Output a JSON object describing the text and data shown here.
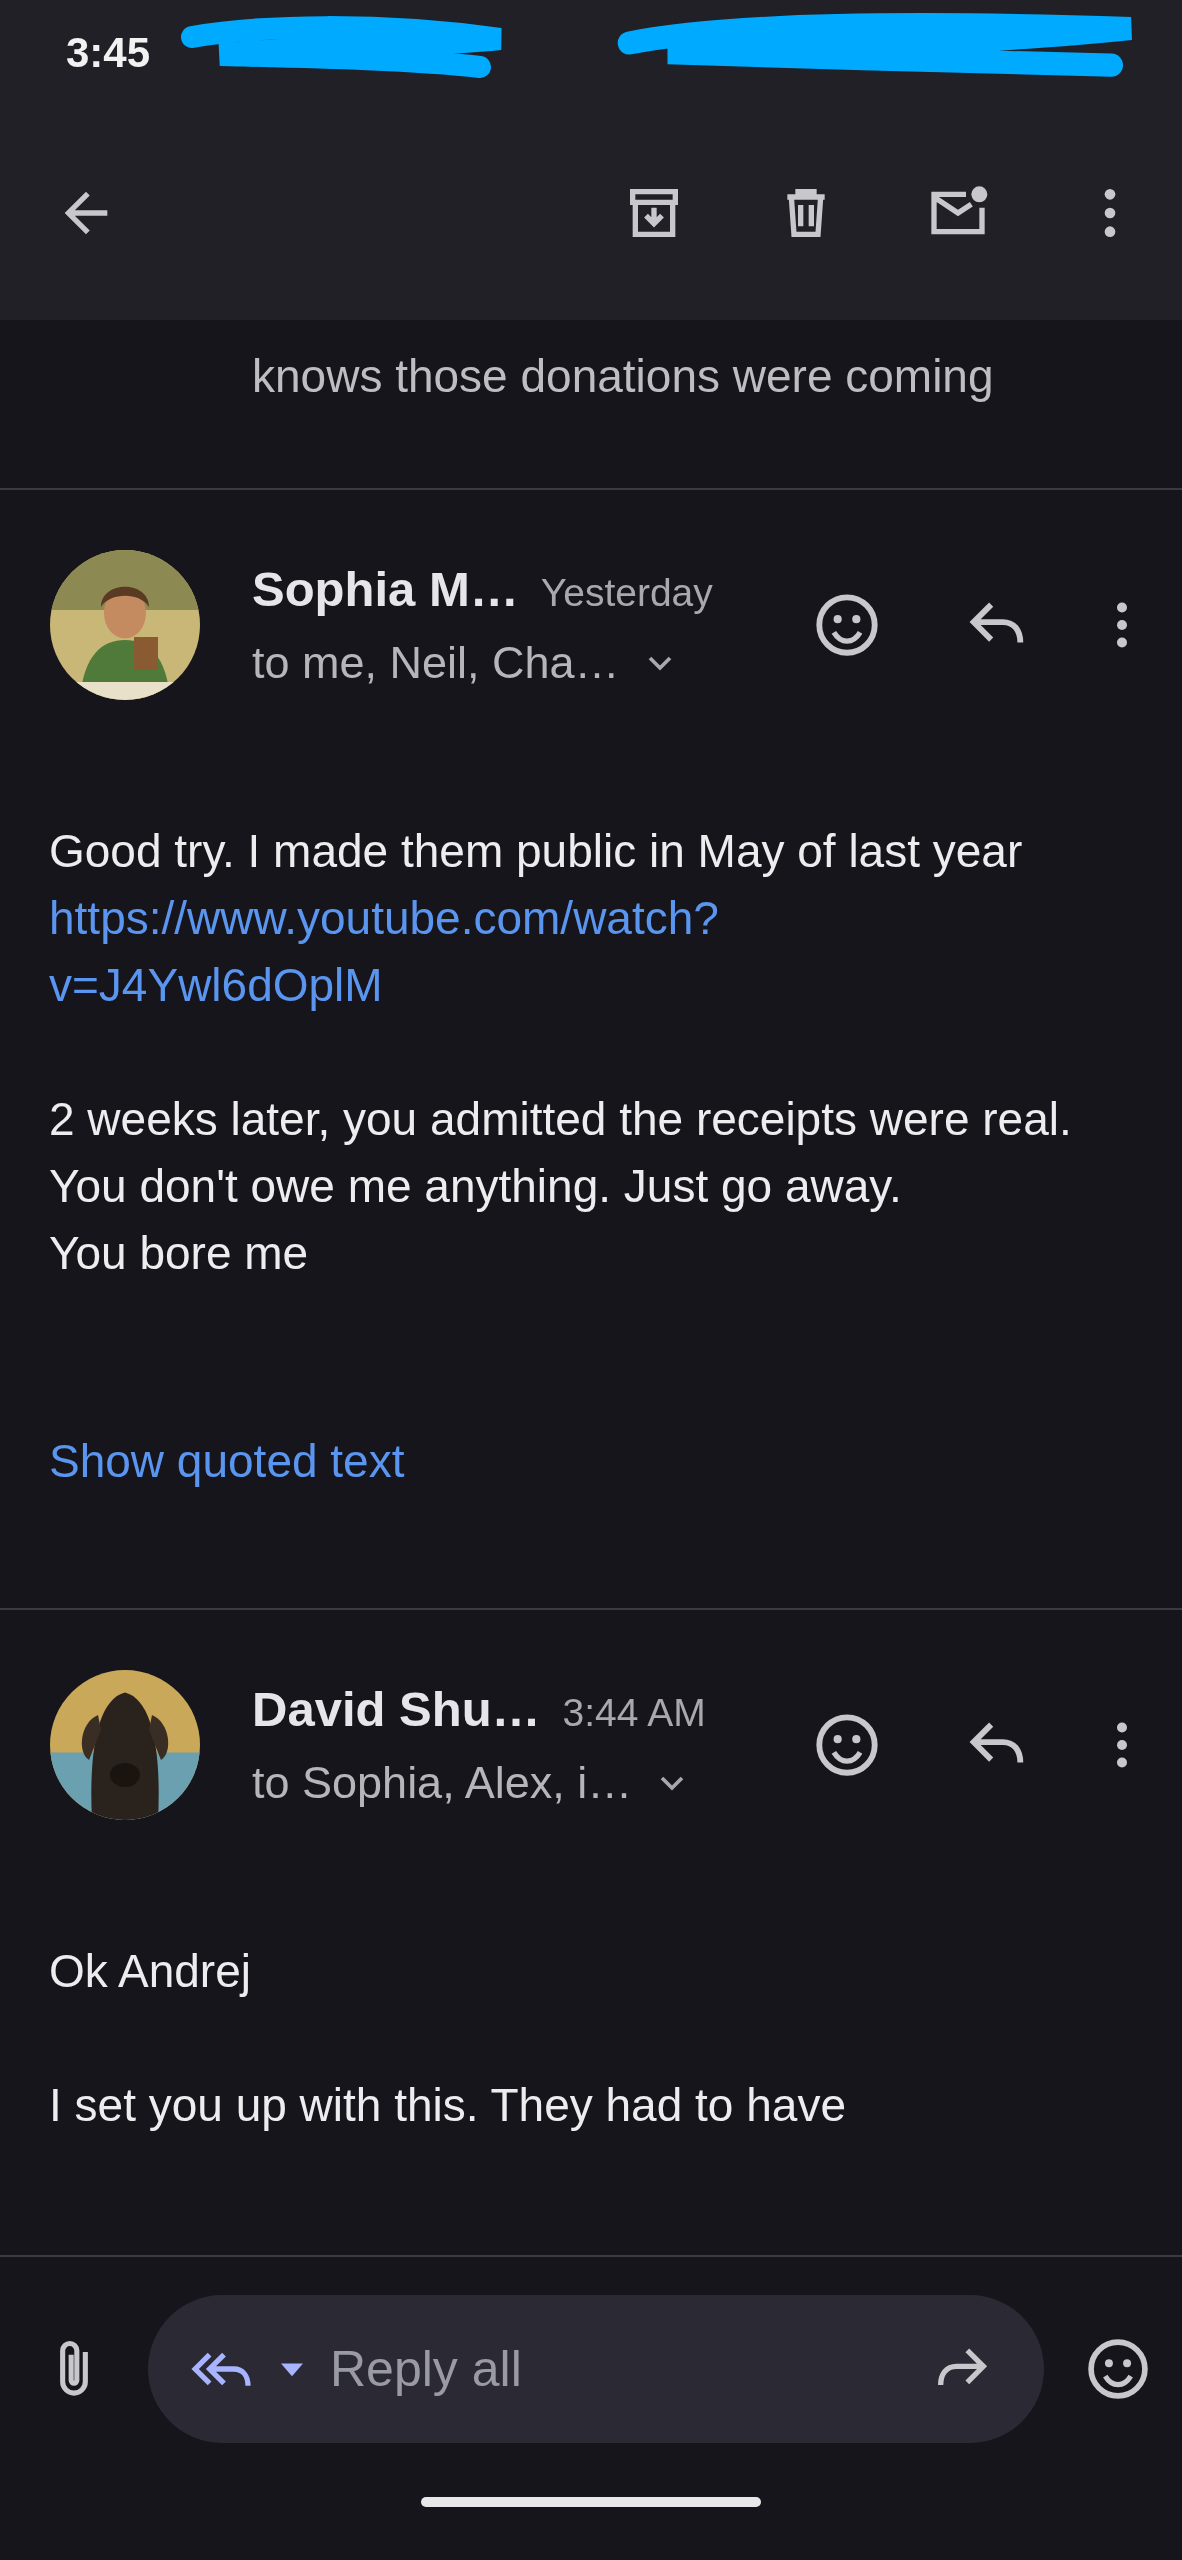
{
  "status_bar": {
    "time": "3:45"
  },
  "previous_message": {
    "lines": [
      "knows those donations were coming"
    ]
  },
  "messages": [
    {
      "sender": "Sophia M…",
      "time": "Yesterday",
      "recipients": "to me, Neil, Cha…",
      "avatar": {
        "kind": "picture"
      },
      "paragraphs": [
        {
          "lines": [
            {
              "kind": "text",
              "text": "Good try. I made them public in May of last year"
            },
            {
              "kind": "link",
              "lines": [
                "https://www.youtube.com/watch?",
                "v=J4Ywl6dOplM"
              ]
            }
          ]
        },
        {
          "lines": [
            {
              "kind": "text",
              "text": "2 weeks later, you admitted the receipts were real."
            },
            {
              "kind": "text",
              "text": "You don't owe me anything. Just go away."
            },
            {
              "kind": "text",
              "text": "You bore me"
            }
          ]
        }
      ],
      "show_quoted": "Show quoted text"
    },
    {
      "sender": "David Shu…",
      "time": "3:44 AM",
      "recipients": "to Sophia, Alex, i…",
      "avatar": {
        "kind": "picture"
      },
      "paragraphs": [
        {
          "lines": [
            {
              "kind": "text",
              "text": "Ok Andrej"
            }
          ]
        },
        {
          "lines": [
            {
              "kind": "text",
              "text": "I set you up with this. They had to have"
            }
          ]
        }
      ]
    }
  ],
  "reply_bar": {
    "label": "Reply all"
  }
}
